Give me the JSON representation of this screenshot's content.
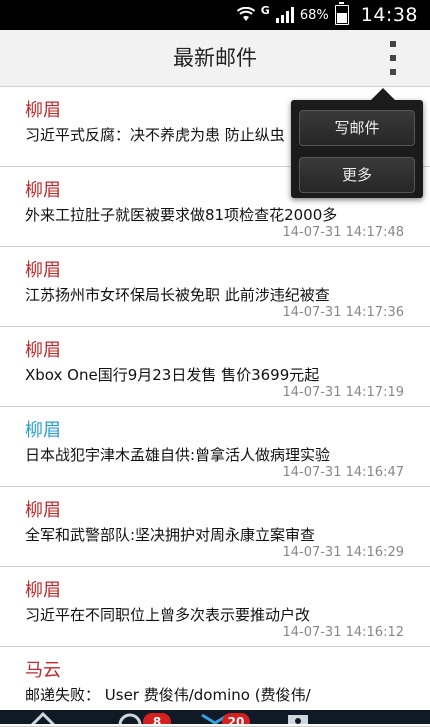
{
  "status_bar": {
    "network": "G",
    "battery": "68%",
    "battery_level": 0.68,
    "time": "14:38"
  },
  "header": {
    "title": "最新邮件"
  },
  "menu": {
    "items": [
      {
        "label": "写邮件"
      },
      {
        "label": "更多"
      }
    ]
  },
  "emails": [
    {
      "sender": "柳眉",
      "subject": "习近平式反腐：决不养虎为患 防止纵虫",
      "date": "",
      "sender_color": "red"
    },
    {
      "sender": "柳眉",
      "subject": "外来工拉肚子就医被要求做81项检查花2000多",
      "date": "14-07-31 14:17:48",
      "sender_color": "red"
    },
    {
      "sender": "柳眉",
      "subject": "江苏扬州市女环保局长被免职 此前涉违纪被查",
      "date": "14-07-31 14:17:36",
      "sender_color": "red"
    },
    {
      "sender": "柳眉",
      "subject": "Xbox One国行9月23日发售 售价3699元起",
      "date": "14-07-31 14:17:19",
      "sender_color": "red"
    },
    {
      "sender": "柳眉",
      "subject": "日本战犯宇津木孟雄自供:曾拿活人做病理实验",
      "date": "14-07-31 14:16:47",
      "sender_color": "blue"
    },
    {
      "sender": "柳眉",
      "subject": "全军和武警部队:坚决拥护对周永康立案审查",
      "date": "14-07-31 14:16:29",
      "sender_color": "red"
    },
    {
      "sender": "柳眉",
      "subject": "习近平在不同职位上曾多次表示要推动户改",
      "date": "14-07-31 14:16:12",
      "sender_color": "red"
    },
    {
      "sender": "马云",
      "subject": "邮递失败： User 费俊伟/domino (费俊伟/",
      "date": "",
      "sender_color": "red"
    }
  ],
  "bottom_bar": {
    "badge_1": "8",
    "badge_2": "20"
  },
  "colors": {
    "sender_red": "#c22a2a",
    "sender_blue": "#2a9fd0",
    "badge_red": "#d62020"
  }
}
